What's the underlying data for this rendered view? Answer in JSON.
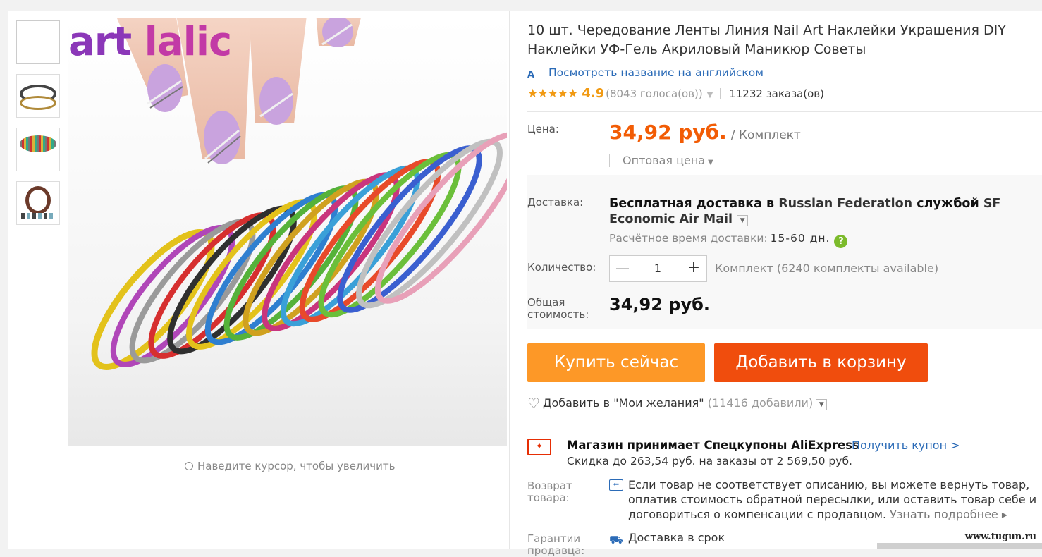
{
  "gallery": {
    "logo_text_1": "art ",
    "logo_text_2": "lalic",
    "zoom_hint": "Наведите курсор, чтобы увеличить"
  },
  "product": {
    "title": "10 шт. Чередование Ленты Линия Nail Art Наклейки Украшения DIY Наклейки УФ-Гель Акриловый Маникюр Советы",
    "translate_link": "Посмотреть название на английском",
    "translate_icon": "А",
    "stars": "★★★★★",
    "rating": "4.9",
    "votes": "(8043 голоса(ов))",
    "orders": "11232 заказа(ов)"
  },
  "price": {
    "label": "Цена:",
    "value": "34,92 руб.",
    "unit": "/ Комплект",
    "wholesale": "Оптовая цена"
  },
  "delivery": {
    "label": "Доставка:",
    "text_prefix": "Бесплатная доставка в ",
    "country": "Russian Federation",
    "text_middle": " службой ",
    "service": "SF Economic Air Mail",
    "eta_label": "Расчётное время доставки:",
    "eta_days": "15-60 дн."
  },
  "quantity": {
    "label": "Количество:",
    "value": "1",
    "available": "Комплект (6240 комплекты available)"
  },
  "total": {
    "label": "Общая стоимость:",
    "value": "34,92 руб."
  },
  "actions": {
    "buy_now": "Купить сейчас",
    "add_to_cart": "Добавить в корзину",
    "wishlist": "Добавить в \"Мои желания\"",
    "wishlist_count": "(11416 добавили)"
  },
  "coupon": {
    "title": "Магазин принимает Спецкупоны AliExpress",
    "link": "Получить купон >",
    "subtitle": "Скидка до 263,54 руб. на заказы от 2 569,50 руб."
  },
  "returns": {
    "label": "Возврат товара:",
    "text": "Если товар не соответствует описанию, вы можете вернуть товар, оплатив стоимость обратной пересылки, или оставить товар себе и договориться о компенсации с продавцом.",
    "more": "Узнать подробнее ▸"
  },
  "guarantee": {
    "label": "Гарантии продавца:",
    "item": "Доставка в срок"
  },
  "watermark": "www.tugun.ru",
  "colors": {
    "accent_orange": "#f25c05",
    "buy_button": "#fd9827",
    "cart_button": "#f04d0d",
    "link_blue": "#2b6bb7",
    "star": "#f19a13"
  }
}
